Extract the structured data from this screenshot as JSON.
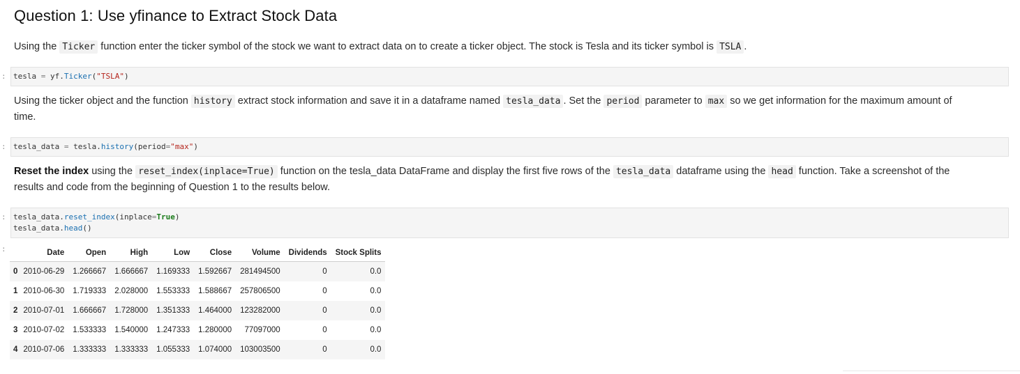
{
  "heading": "Question 1: Use yfinance to Extract Stock Data",
  "para1": {
    "t1": "Using the ",
    "c1": "Ticker",
    "t2": " function enter the ticker symbol of the stock we want to extract data on to create a ticker object. The stock is Tesla and its ticker symbol is ",
    "c2": "TSLA",
    "t3": "."
  },
  "cell1": {
    "prompt": ":",
    "var": "tesla",
    "op": " = ",
    "obj": "yf.",
    "func": "Ticker",
    "open": "(",
    "arg": "\"TSLA\"",
    "close": ")"
  },
  "para2": {
    "t1": "Using the ticker object and the function ",
    "c1": "history",
    "t2": " extract stock information and save it in a dataframe named ",
    "c2": "tesla_data",
    "t3": ". Set the ",
    "c3": "period",
    "t4": " parameter to ",
    "c4": "max",
    "t5": " so we get information for the maximum amount of",
    "line2": "time."
  },
  "cell2": {
    "prompt": ":",
    "var": "tesla_data",
    "op": " = ",
    "obj": "tesla.",
    "func": "history",
    "open": "(period",
    "eq": "=",
    "arg": "\"max\"",
    "close": ")"
  },
  "para3": {
    "b1": "Reset the index",
    "t1": " using the ",
    "c1": "reset_index(inplace=True)",
    "t2": " function on the tesla_data DataFrame and display the first five rows of the ",
    "c2": "tesla_data",
    "t3": " dataframe using the ",
    "c3": "head",
    "t4": " function. Take a screenshot of the",
    "line2": "results and code from the beginning of Question 1 to the results below."
  },
  "cell3": {
    "prompt": ":",
    "l1_obj": "tesla_data.",
    "l1_func": "reset_index",
    "l1_open": "(inplace",
    "l1_eq": "=",
    "l1_kw": "True",
    "l1_close": ")",
    "l2_obj": "tesla_data.",
    "l2_func": "head",
    "l2_args": "()"
  },
  "output_prompt": ":",
  "table": {
    "columns": [
      "",
      "Date",
      "Open",
      "High",
      "Low",
      "Close",
      "Volume",
      "Dividends",
      "Stock Splits"
    ],
    "rows": [
      [
        "0",
        "2010-06-29",
        "1.266667",
        "1.666667",
        "1.169333",
        "1.592667",
        "281494500",
        "0",
        "0.0"
      ],
      [
        "1",
        "2010-06-30",
        "1.719333",
        "2.028000",
        "1.553333",
        "1.588667",
        "257806500",
        "0",
        "0.0"
      ],
      [
        "2",
        "2010-07-01",
        "1.666667",
        "1.728000",
        "1.351333",
        "1.464000",
        "123282000",
        "0",
        "0.0"
      ],
      [
        "3",
        "2010-07-02",
        "1.533333",
        "1.540000",
        "1.247333",
        "1.280000",
        "77097000",
        "0",
        "0.0"
      ],
      [
        "4",
        "2010-07-06",
        "1.333333",
        "1.333333",
        "1.055333",
        "1.074000",
        "103003500",
        "0",
        "0.0"
      ]
    ]
  }
}
